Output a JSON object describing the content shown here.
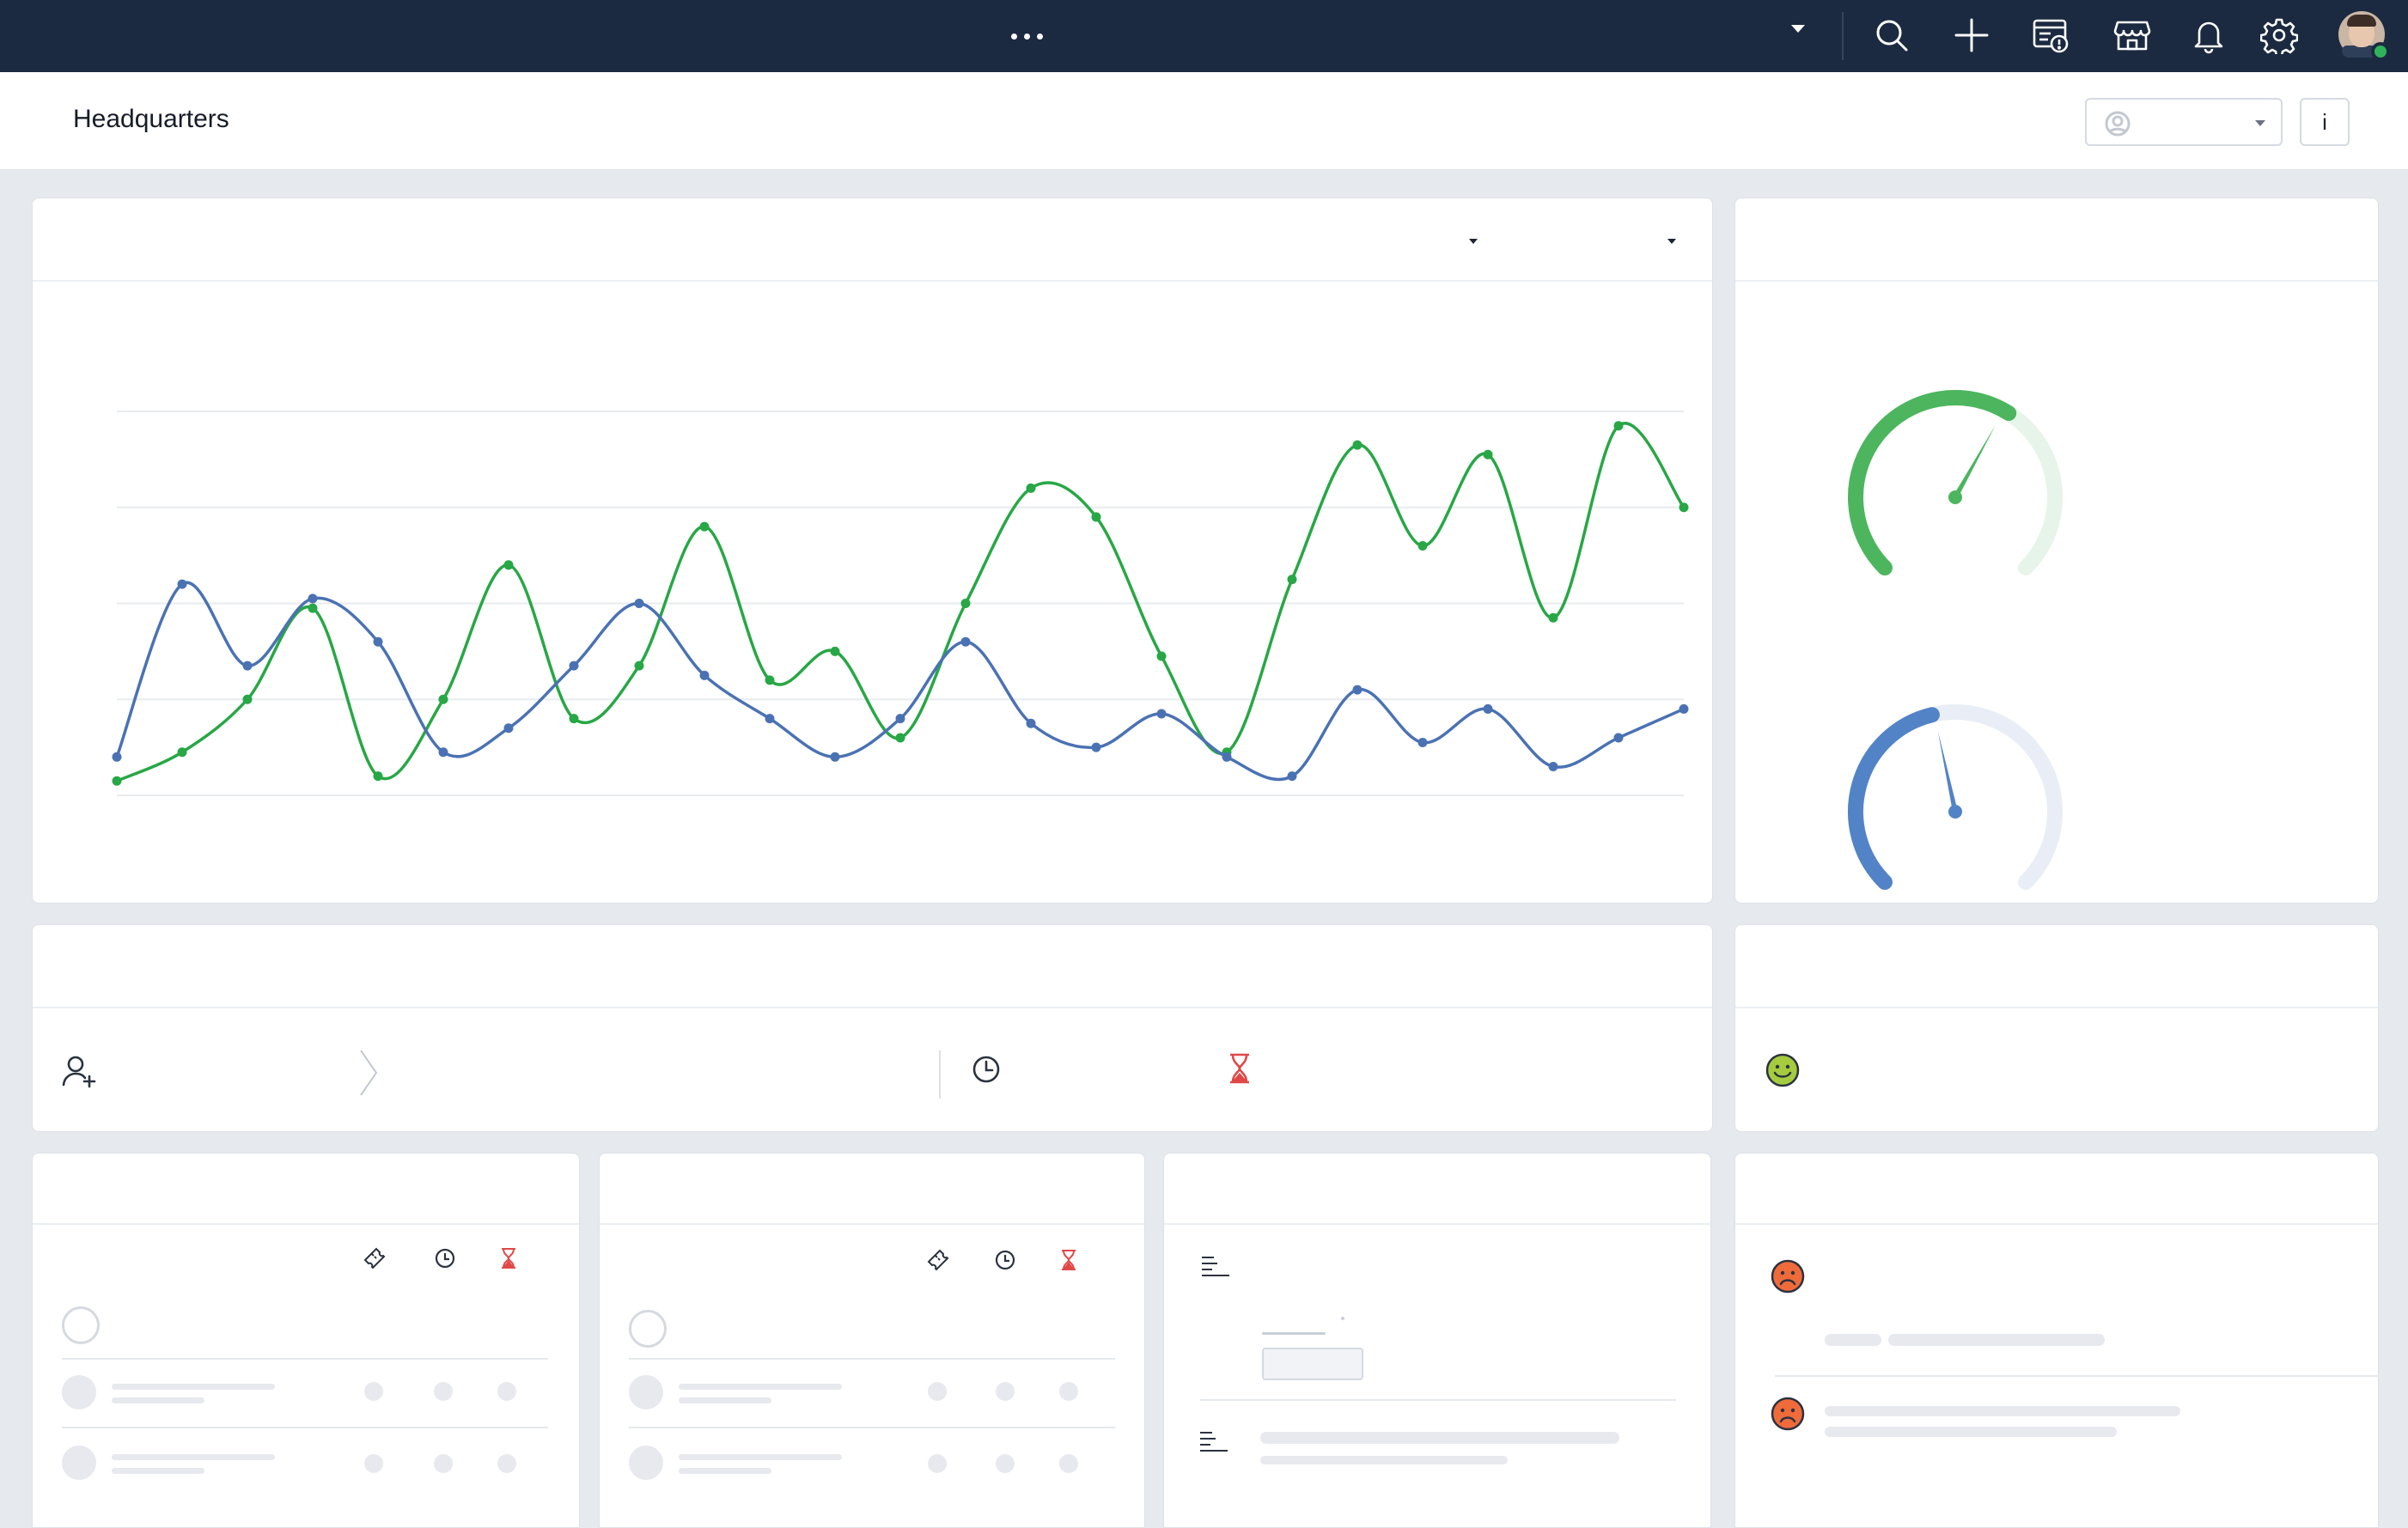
{
  "topbar": {
    "more_label": "more-options",
    "icons": [
      "search-icon",
      "add-icon",
      "ticket-alert-icon",
      "marketplace-icon",
      "bell-icon",
      "gear-icon",
      "avatar"
    ]
  },
  "header": {
    "title": "Headquarters",
    "info_label": "i"
  },
  "colors": {
    "topbar": "#1b2a41",
    "series_green": "#27a745",
    "series_blue": "#4a72b3",
    "gauge_green": "#4cb55e",
    "gauge_blue": "#5283c6",
    "alert_red": "#e04848",
    "smiley_green": "#a4cc3e",
    "sad_orange": "#ef6b3a"
  },
  "chart_data": {
    "type": "line",
    "grid": true,
    "ylim": [
      0,
      4
    ],
    "x": [
      0,
      1,
      2,
      3,
      4,
      5,
      6,
      7,
      8,
      9,
      10,
      11,
      12,
      13,
      14,
      15,
      16,
      17,
      18,
      19,
      20,
      21,
      22,
      23,
      24
    ],
    "series": [
      {
        "color": "#27a745",
        "values": [
          0.15,
          0.45,
          1.0,
          1.95,
          0.2,
          1.0,
          2.4,
          0.8,
          1.35,
          2.8,
          1.2,
          1.5,
          0.6,
          2.0,
          3.2,
          2.9,
          1.45,
          0.45,
          2.25,
          3.65,
          2.6,
          3.55,
          1.85,
          3.85,
          3.0
        ]
      },
      {
        "color": "#4a72b3",
        "values": [
          0.4,
          2.2,
          1.35,
          2.05,
          1.6,
          0.45,
          0.7,
          1.35,
          2.0,
          1.25,
          0.8,
          0.4,
          0.8,
          1.6,
          0.75,
          0.5,
          0.85,
          0.4,
          0.2,
          1.1,
          0.55,
          0.9,
          0.3,
          0.6,
          0.9
        ]
      }
    ]
  },
  "gauges": [
    {
      "name": "gauge-top",
      "value": 0.62,
      "color": "#4cb55e",
      "track": "#e7f4e9"
    },
    {
      "name": "gauge-bottom",
      "value": 0.45,
      "color": "#5283c6",
      "track": "#e9eef6"
    }
  ]
}
